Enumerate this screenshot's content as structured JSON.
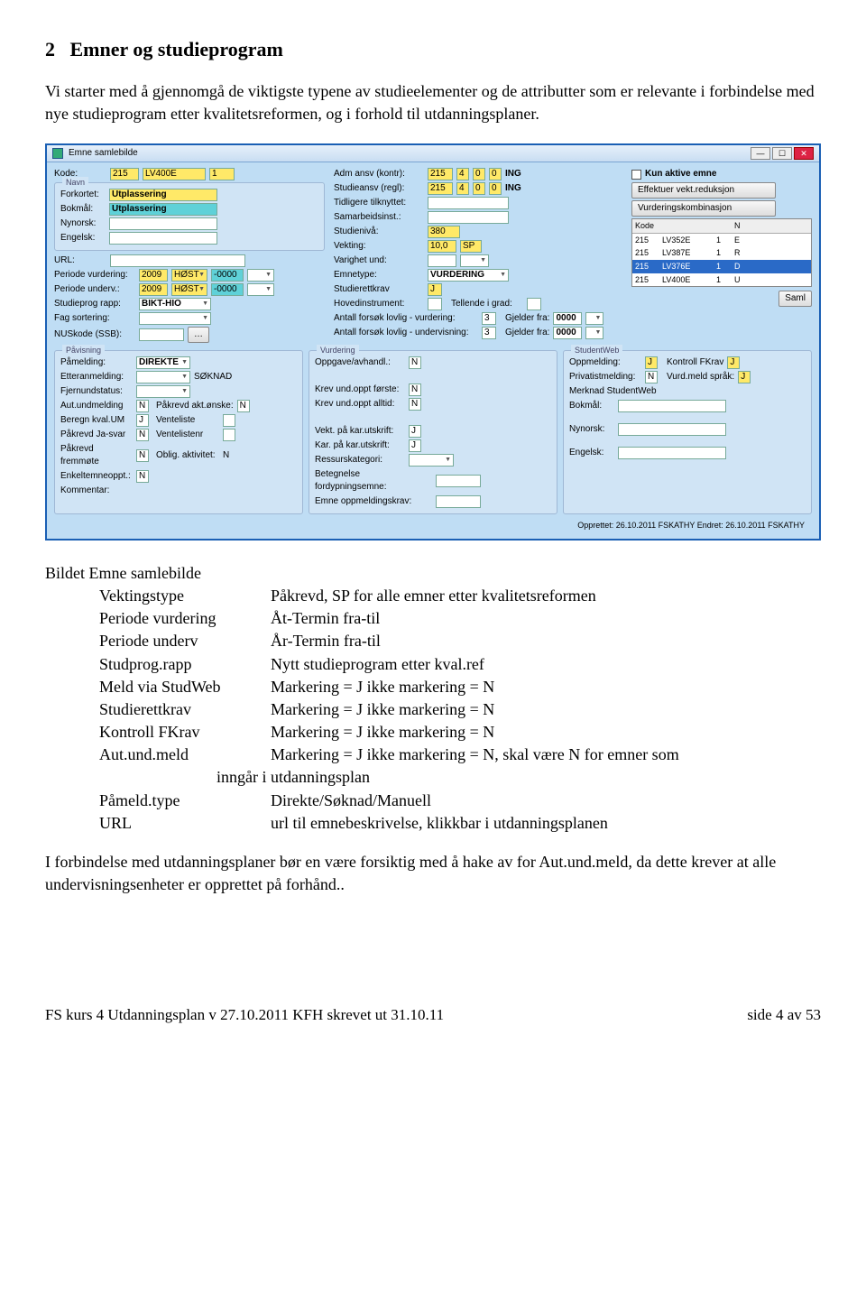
{
  "heading_num": "2",
  "heading_text": "Emner og studieprogram",
  "intro": "Vi starter med å gjennomgå de viktigste typene av studieelementer og de attributter som er relevante i forbindelse med nye studieprogram etter kvalitetsreformen, og i forhold til utdanningsplaner.",
  "screenshot": {
    "title": "Emne samlebilde",
    "kun_aktive": "Kun aktive emne",
    "btn_effektuer": "Effektuer vekt.reduksjon",
    "btn_vurdkomb": "Vurderingskombinasjon",
    "list_head_a": "Kode",
    "list_head_b": "N",
    "list_rows": [
      {
        "a": "215",
        "b": "LV352E",
        "c": "1",
        "d": "E"
      },
      {
        "a": "215",
        "b": "LV387E",
        "c": "1",
        "d": "R"
      },
      {
        "a": "215",
        "b": "LV376E",
        "c": "1",
        "d": "D"
      },
      {
        "a": "215",
        "b": "LV400E",
        "c": "1",
        "d": "U"
      }
    ],
    "btn_saml": "Saml",
    "navn_group": "Navn",
    "lbl_kode": "Kode:",
    "v_kode_a": "215",
    "v_kode_b": "LV400E",
    "v_kode_c": "1",
    "lbl_forkortet": "Forkortet:",
    "v_forkortet": "Utplassering",
    "lbl_bokmal": "Bokmål:",
    "v_bokmal": "Utplassering",
    "lbl_nynorsk": "Nynorsk:",
    "lbl_engelsk": "Engelsk:",
    "lbl_url": "URL:",
    "lbl_periode_vurd": "Periode vurdering:",
    "v_pv_a": "2009",
    "v_pv_b": "HØST",
    "v_pv_c": "-0000",
    "lbl_periode_und": "Periode underv.:",
    "lbl_studprog": "Studieprog rapp:",
    "v_studprog": "BIKT-HIO",
    "lbl_fagsort": "Fag sortering:",
    "lbl_nuskode": "NUSkode (SSB):",
    "lbl_admansv": "Adm ansv (kontr):",
    "v_adm_a": "215",
    "v_adm_b": "4",
    "v_adm_c": "0",
    "v_adm_d": "0",
    "v_adm_e": "ING",
    "lbl_studieansv": "Studieansv (regl):",
    "lbl_tidligere": "Tidligere tilknyttet:",
    "lbl_samarbeid": "Samarbeidsinst.:",
    "lbl_studieniva": "Studienivå:",
    "v_studieniva": "380",
    "lbl_vekting": "Vekting:",
    "v_vekting_a": "10,0",
    "v_vekting_b": "SP",
    "lbl_varighet": "Varighet und:",
    "lbl_emnetype": "Emnetype:",
    "v_emnetype": "VURDERING",
    "lbl_studierett": "Studierettkrav",
    "v_studierett": "J",
    "lbl_hovedinstr": "Hovedinstrument:",
    "lbl_tellende": "Tellende i grad:",
    "lbl_antall_vurd": "Antall forsøk lovlig - vurdering:",
    "v_antall": "3",
    "lbl_gjelder": "Gjelder fra:",
    "v_gjelder": "0000",
    "lbl_antall_und": "Antall forsøk lovlig - undervisning:",
    "pavisning": "Påvisning",
    "lbl_pamelding": "Påmelding:",
    "v_pamelding": "DIREKTE",
    "lbl_etteranmeld": "Etteranmelding:",
    "v_soknad": "SØKNAD",
    "lbl_fjernund": "Fjernundstatus:",
    "lbl_autund": "Aut.undmelding",
    "v_n": "N",
    "v_j": "J",
    "lbl_pakrevd_akt": "Påkrevd akt.ønske:",
    "lbl_beregn": "Beregn kval.UM",
    "lbl_venteliste": "Venteliste",
    "lbl_pakrevd_ja": "Påkrevd Ja-svar",
    "lbl_ventelistenr": "Ventelistenr",
    "lbl_pakrevd_fremm": "Påkrevd fremmøte",
    "lbl_oblig": "Oblig. aktivitet:",
    "lbl_enkeltemne": "Enkeltemneoppt.:",
    "lbl_kommentar": "Kommentar:",
    "vurdering": "Vurdering",
    "lbl_oppgave": "Oppgave/avhandl.:",
    "lbl_krev_forste": "Krev und.oppt første:",
    "lbl_krev_alltid": "Krev und.oppt alltid:",
    "lbl_vekt_kar": "Vekt. på kar.utskrift:",
    "lbl_kar_kar": "Kar. på kar.utskrift:",
    "lbl_ressurs": "Ressurskategori:",
    "lbl_betegnelse": "Betegnelse fordypningsemne:",
    "lbl_emne_oppm": "Emne oppmeldingskrav:",
    "studentweb": "StudentWeb",
    "lbl_oppmelding": "Oppmelding:",
    "lbl_kontroll": "Kontroll FKrav",
    "lbl_privatist": "Privatistmelding:",
    "lbl_vurdmeld": "Vurd.meld språk:",
    "lbl_merknad": "Merknad StudentWeb",
    "opprettet": "Opprettet: 26.10.2011    FSKATHY Endret: 26.10.2011    FSKATHY"
  },
  "after": {
    "title": "Bildet Emne samlebilde",
    "rows": [
      {
        "k": "Vektingstype",
        "v": "Påkrevd, SP for alle emner etter kvalitetsreformen"
      },
      {
        "k": "Periode vurdering",
        "v": "Åt-Termin fra-til"
      },
      {
        "k": "Periode underv",
        "v": "År-Termin fra-til"
      },
      {
        "k": "Studprog.rapp",
        "v": "Nytt studieprogram etter kval.ref"
      },
      {
        "k": "Meld via StudWeb",
        "v": "Markering = J ikke markering = N"
      },
      {
        "k": "Studierettkrav",
        "v": "Markering = J ikke markering = N"
      },
      {
        "k": "Kontroll FKrav",
        "v": "Markering = J ikke markering = N"
      },
      {
        "k": "Aut.und.meld",
        "v": "Markering = J ikke markering = N, skal være N for emner som"
      }
    ],
    "cont": "inngår i utdanningsplan",
    "rows2": [
      {
        "k": "Påmeld.type",
        "v": "Direkte/Søknad/Manuell"
      },
      {
        "k": "URL",
        "v": "url til emnebeskrivelse, klikkbar i utdanningsplanen"
      }
    ],
    "closing": "I forbindelse med utdanningsplaner bør en være forsiktig med å hake av for Aut.und.meld, da dette krever at alle undervisningsenheter er opprettet på forhånd.."
  },
  "footer_left": "FS kurs 4 Utdanningsplan v 27.10.2011 KFH skrevet ut 31.10.11",
  "footer_right": "side 4 av 53"
}
